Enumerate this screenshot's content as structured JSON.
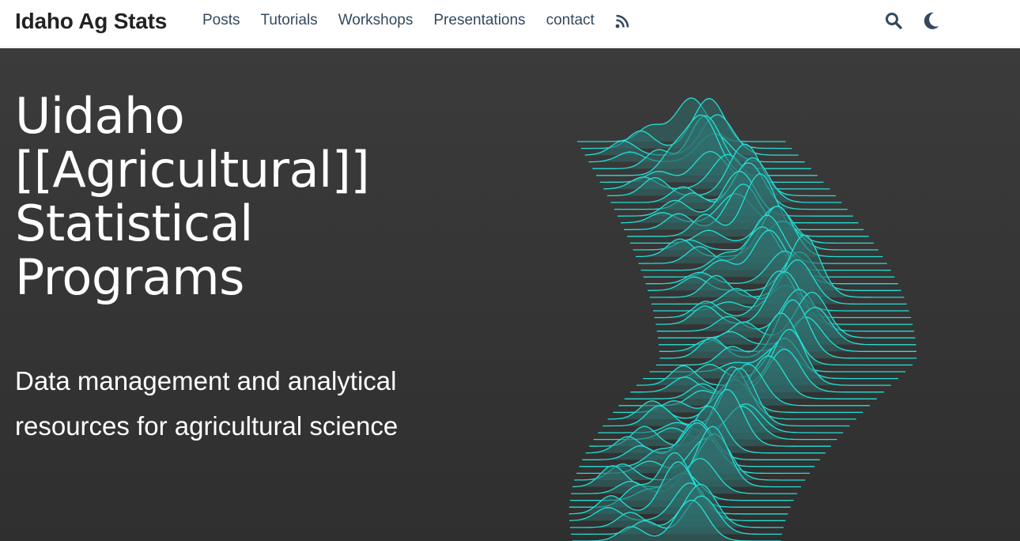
{
  "navbar": {
    "brand": "Idaho Ag Stats",
    "links": [
      "Posts",
      "Tutorials",
      "Workshops",
      "Presentations",
      "contact"
    ],
    "rss_icon": "rss-icon",
    "search_icon": "search-icon",
    "theme_icon": "moon-icon"
  },
  "hero": {
    "title": "Uidaho\n[[Agricultural]]\nStatistical\nPrograms",
    "subtitle": "Data management and analytical\nresources for agricultural science",
    "graphic": "ridgeline-illustration",
    "ridge_color": "#22e0d6"
  },
  "colors": {
    "nav_text": "#34495e",
    "hero_bg": "#353535",
    "hero_text": "#ffffff"
  }
}
